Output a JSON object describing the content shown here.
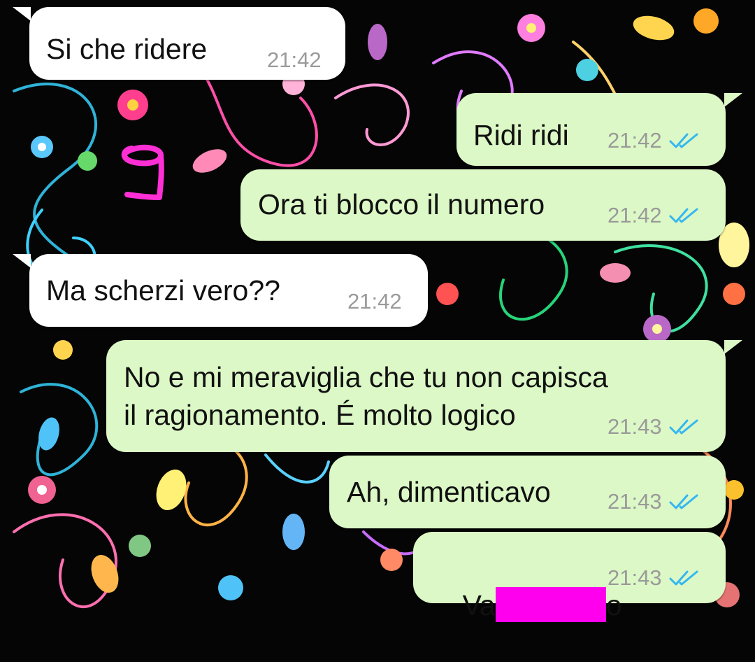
{
  "colors": {
    "incoming_bubble": "#ffffff",
    "outgoing_bubble": "#dcf8c6",
    "timestamp": "#9a9a9a",
    "read_ticks": "#34b7f1",
    "censor_bar": "#ff00ee",
    "annotation": "#ff2fd6"
  },
  "chat": {
    "messages": [
      {
        "direction": "incoming",
        "text": "Si che ridere",
        "time": "21:42"
      },
      {
        "direction": "outgoing",
        "text": "Ridi ridi",
        "time": "21:42",
        "status_icon": "double-check-read-icon"
      },
      {
        "direction": "outgoing",
        "text": "Ora ti blocco il numero",
        "time": "21:42",
        "status_icon": "double-check-read-icon"
      },
      {
        "direction": "incoming",
        "text": "Ma scherzi vero??",
        "time": "21:42"
      },
      {
        "direction": "outgoing",
        "text_line1": "No e mi meraviglia che tu non capisca",
        "text_line2": "il ragionamento. É molto logico",
        "time": "21:43",
        "status_icon": "double-check-read-icon"
      },
      {
        "direction": "outgoing",
        "text": "Ah, dimenticavo",
        "time": "21:43",
        "status_icon": "double-check-read-icon"
      },
      {
        "direction": "outgoing",
        "text_prefix": "Va",
        "text_suffix": "o",
        "time": "21:43",
        "status_icon": "double-check-read-icon"
      }
    ]
  },
  "annotation": {
    "mark": "handwritten-9-annotation"
  }
}
